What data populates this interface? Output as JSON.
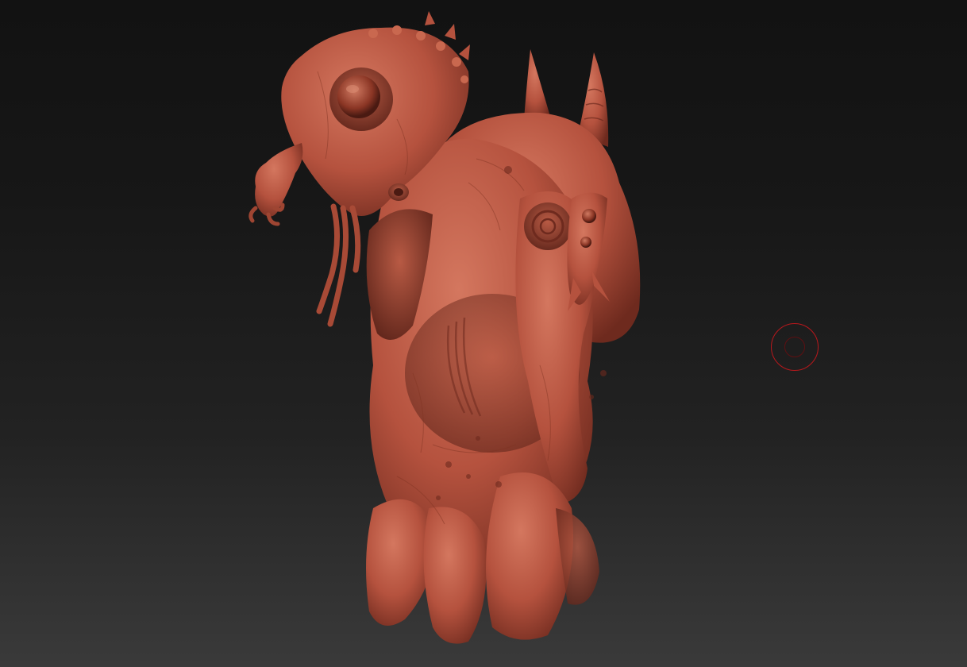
{
  "viewport": {
    "background_top": "#121212",
    "background_bottom": "#3a3a3a"
  },
  "model": {
    "material_color": "#b5523e",
    "shadow_color": "#6e2a1e",
    "highlight_color": "#d4775f"
  },
  "brush_cursor": {
    "outer_color": "#b8181c",
    "inner_color": "#5e1012"
  }
}
